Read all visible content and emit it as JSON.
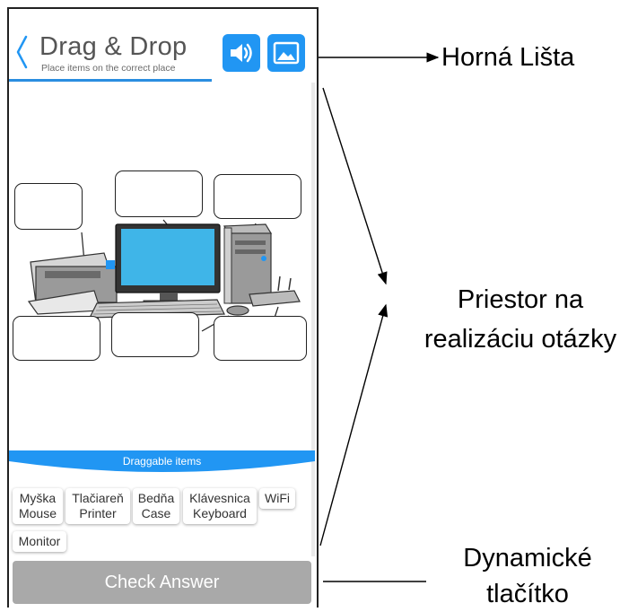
{
  "app": {
    "title": "Drag & Drop",
    "subtitle": "Place items on the correct place",
    "accent_color": "#2196f3",
    "icons": [
      "back-chevron-icon",
      "sound-icon",
      "image-icon"
    ]
  },
  "panel": {
    "title": "Draggable items",
    "items": [
      {
        "line1": "Myška",
        "line2": "Mouse"
      },
      {
        "line1": "Tlačiareň",
        "line2": "Printer"
      },
      {
        "line1": "Bedňa",
        "line2": "Case"
      },
      {
        "line1": "Klávesnica",
        "line2": "Keyboard"
      },
      {
        "line1": "WiFi",
        "line2": ""
      },
      {
        "line1": "Monitor",
        "line2": ""
      }
    ]
  },
  "check_button": {
    "label": "Check Answer",
    "color": "#a9a9a9"
  },
  "annotations": {
    "top_bar": "Horná Lišta",
    "question_area_line1": "Priestor na",
    "question_area_line2": "realizáciu otázky",
    "dynamic_button_line1": "Dynamické",
    "dynamic_button_line2": "tlačítko"
  }
}
